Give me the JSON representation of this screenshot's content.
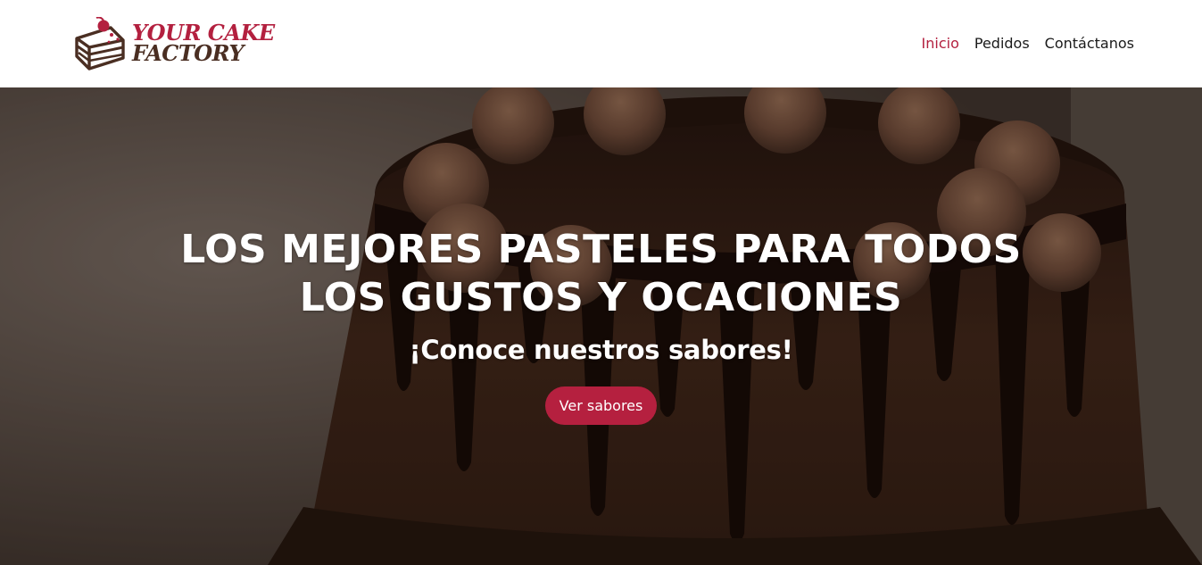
{
  "brand": {
    "line1": "YOUR CAKE",
    "line2": "FACTORY",
    "logo_icon": "cake-slice-with-cherry-icon"
  },
  "nav": {
    "items": [
      {
        "label": "Inicio",
        "active": true
      },
      {
        "label": "Pedidos",
        "active": false
      },
      {
        "label": "Contáctanos",
        "active": false
      }
    ]
  },
  "hero": {
    "title_line1": "LOS MEJORES PASTELES PARA TODOS",
    "title_line2": "LOS GUSTOS Y OCACIONES",
    "subtitle": "¡Conoce nuestros sabores!",
    "button_label": "Ver sabores",
    "background": "chocolate-drip-cake-photo"
  },
  "colors": {
    "accent": "#b5203f",
    "brand_dark": "#4a2e22",
    "nav_text": "#1a1a1a",
    "hero_text": "#ffffff"
  }
}
